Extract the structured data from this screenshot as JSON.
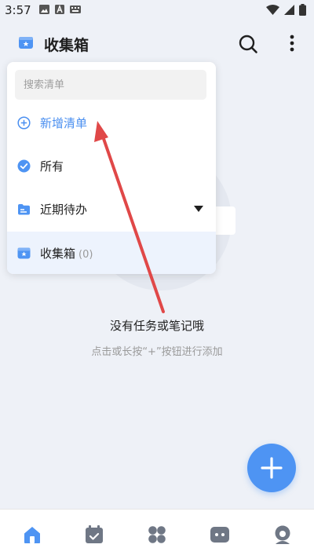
{
  "status_bar": {
    "time": "3:57",
    "left_icons": [
      "image-icon",
      "a-letter-icon",
      "keyboard-icon"
    ],
    "right_icons": [
      "wifi-icon",
      "signal-icon",
      "battery-icon"
    ]
  },
  "header": {
    "title": "收集箱",
    "icons": [
      "inbox-icon",
      "search-icon",
      "more-vertical-icon"
    ]
  },
  "dropdown": {
    "search_placeholder": "搜索清单",
    "items": [
      {
        "label": "新增清单",
        "icon": "add-circle-icon"
      },
      {
        "label": "所有",
        "icon": "check-circle-icon"
      },
      {
        "label": "近期待办",
        "icon": "recent-folder-icon",
        "has_caret": true
      },
      {
        "label": "收集箱",
        "icon": "inbox-icon",
        "count": "(0)",
        "selected": true
      }
    ]
  },
  "empty_state": {
    "title": "没有任务或笔记哦",
    "subtitle": "点击或长按“+”按钮进行添加"
  },
  "fab": {
    "icon": "plus-icon"
  },
  "bottom_nav": [
    {
      "icon": "home-icon",
      "active": true
    },
    {
      "icon": "calendar-icon",
      "active": false
    },
    {
      "icon": "apps-icon",
      "active": false
    },
    {
      "icon": "robot-icon",
      "active": false
    },
    {
      "icon": "profile-icon",
      "active": false
    }
  ],
  "colors": {
    "accent": "#4e94f3",
    "annotation": "#e04848",
    "background": "#eef1f7",
    "selected_row": "#edf3fd"
  }
}
